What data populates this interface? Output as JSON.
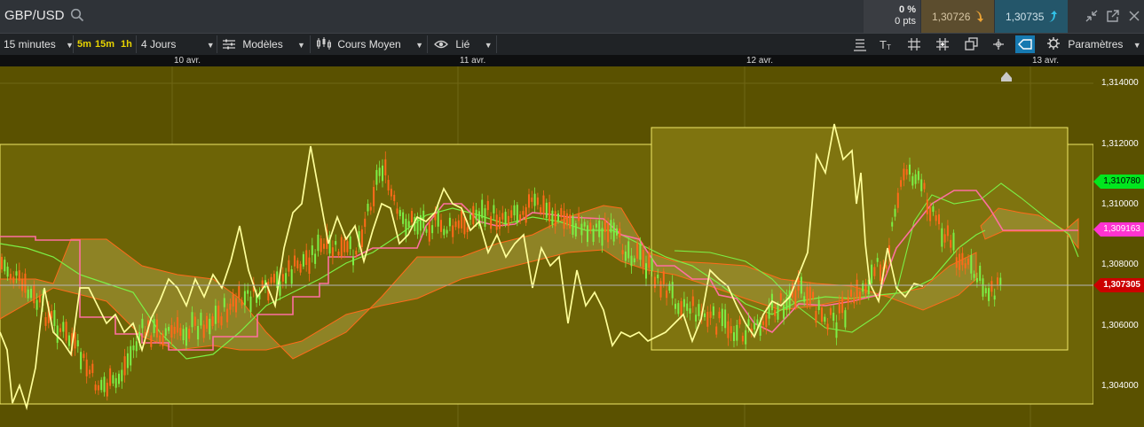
{
  "header": {
    "symbol": "GBP/USD",
    "change_pct": "0 %",
    "change_pts": "0 pts",
    "sell_price": "1,30726",
    "buy_price": "1,30735"
  },
  "toolbar": {
    "interval": "15 minutes",
    "quick_intervals": [
      "5m",
      "15m",
      "1h"
    ],
    "range": "4 Jours",
    "models": "Modèles",
    "price_type": "Cours Moyen",
    "link": "Lié",
    "settings": "Paramètres"
  },
  "date_labels": [
    "10 avr.",
    "11 avr.",
    "12 avr.",
    "13 avr."
  ],
  "y_axis": {
    "ticks": [
      "1,314000",
      "1,312000",
      "1,310000",
      "1,308000",
      "1,306000",
      "1,304000"
    ],
    "tags": [
      {
        "label": "1,310780",
        "color": "#00e61e",
        "text_color": "#000000"
      },
      {
        "label": "1,309163",
        "color": "#ff33d2",
        "text_color": "#ffffff"
      },
      {
        "label": "1,307305",
        "color": "#cc0000",
        "text_color": "#ffffff"
      }
    ]
  },
  "colors": {
    "background": "#5a5100",
    "price_line": "#ffff99",
    "pink_line": "#ff6fa0",
    "green_line": "#7cf046",
    "cloud": "#9a8d30",
    "cloud_edge": "#ff6a1a"
  },
  "icons": [
    "search-icon",
    "shrink-icon",
    "popout-icon",
    "close-icon",
    "models-icon",
    "candle-icon",
    "eye-icon",
    "layers-icon",
    "text-icon",
    "grid-icon",
    "crosshair-grid-icon",
    "copy-icon",
    "cursor-icon",
    "tag-icon",
    "gear-icon",
    "arrow-down-icon",
    "arrow-up-icon",
    "home-marker-icon"
  ]
}
